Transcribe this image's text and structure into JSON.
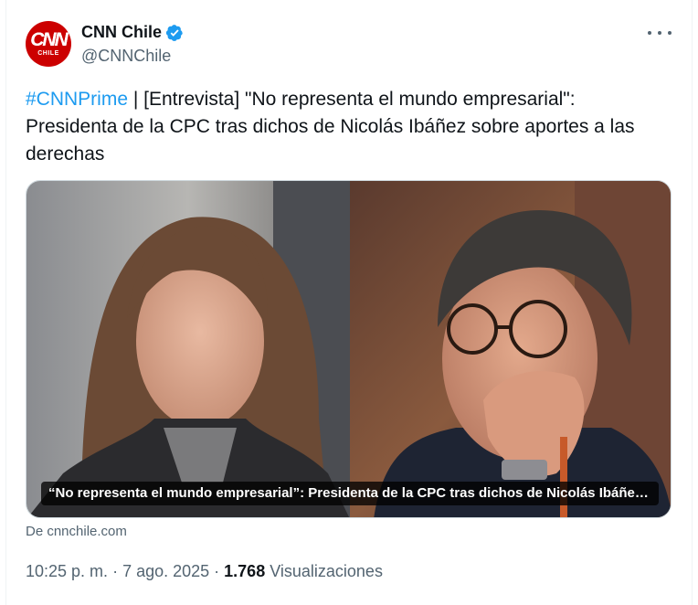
{
  "author": {
    "display_name": "CNN Chile",
    "handle": "@CNNChile",
    "avatar_logo_top": "CNN",
    "avatar_logo_bottom": "CHILE",
    "verified_icon": "verified-badge-icon",
    "more_icon": "more-options-icon"
  },
  "tweet": {
    "hashtag": "#CNNPrime",
    "text": " | [Entrevista] \"No representa el mundo empresarial\": Presidenta de la CPC tras dichos de Nicolás Ibáñez sobre aportes a las derechas"
  },
  "card": {
    "caption": "“No representa el mundo empresarial”: Presidenta de la CPC tras dichos de Nicolás Ibáñez sobre aportes a las derechas",
    "source": "De cnnchile.com"
  },
  "meta": {
    "time": "10:25 p. m.",
    "separator": " · ",
    "date": "7 ago. 2025",
    "views_count": "1.768",
    "views_label": " Visualizaciones"
  },
  "colors": {
    "brand_red": "#cc0000",
    "link_blue": "#1d9bf0",
    "secondary_text": "#536471"
  }
}
